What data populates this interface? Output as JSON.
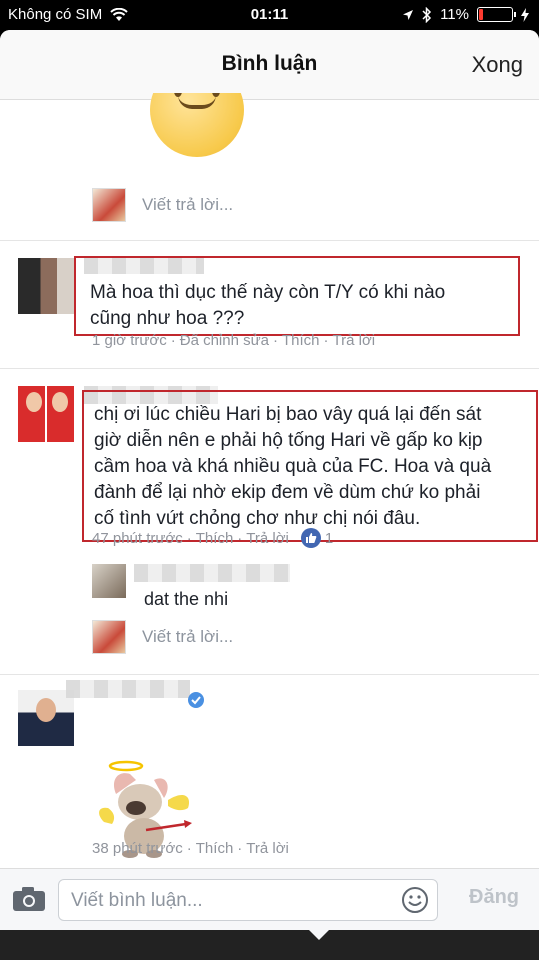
{
  "status_bar": {
    "carrier": "Không có SIM",
    "time": "01:11",
    "battery": "11%"
  },
  "header": {
    "title": "Bình luận",
    "done_label": "Xong"
  },
  "reply_placeholder": "Viết trả lời...",
  "comments": [
    {
      "text_line1": "Mà hoa thì dục thế này còn T/Y có khi nào",
      "text_line2": "cũng như hoa ???",
      "time": "1 giờ trước",
      "edited": "Đã chỉnh sửa",
      "like": "Thích",
      "reply": "Trả lời"
    },
    {
      "text_lines": [
        "chị ơi lúc chiều Hari bị bao vây quá lại đến sát",
        "giờ diễn nên e phải hộ tống Hari về gấp ko kịp",
        "cầm hoa và khá nhiều quà của FC. Hoa và quà",
        "đành để lại nhờ ekip đem về dùm chứ ko phải",
        "cố tình vứt chỏng chơ như chị nói đâu."
      ],
      "time": "47 phút trước",
      "like": "Thích",
      "reply": "Trả lời",
      "like_count": "1",
      "nested_reply": "dat the nhi"
    },
    {
      "time": "38 phút trước",
      "like": "Thích",
      "reply": "Trả lời"
    }
  ],
  "composer": {
    "placeholder": "Viết bình luận...",
    "post_label": "Đăng"
  },
  "colors": {
    "highlight": "#c0272d",
    "like_blue": "#4267b2",
    "muted": "#90949c"
  }
}
